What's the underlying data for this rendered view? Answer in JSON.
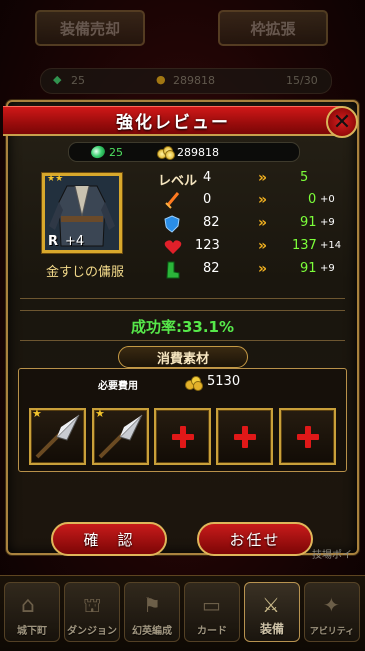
{
  "background": {
    "top_buttons": [
      "装備売却",
      "枠拡張"
    ],
    "status": {
      "gems": "25",
      "coins": "289818",
      "capacity": "15/30"
    }
  },
  "dialog": {
    "title": "強化レビュー",
    "currency": {
      "gems": "25",
      "coins": "289818"
    },
    "item": {
      "rarity": "R",
      "plus": "+4",
      "name": "金すじの傭服",
      "stars": "★★"
    },
    "stats": [
      {
        "label": "レベル",
        "icon": "level-label",
        "current": "4",
        "next": "5",
        "delta": ""
      },
      {
        "label": "",
        "icon": "sword-icon",
        "current": "0",
        "next": "0",
        "delta": "+0"
      },
      {
        "label": "",
        "icon": "shield-icon",
        "current": "82",
        "next": "91",
        "delta": "+9"
      },
      {
        "label": "",
        "icon": "heart-icon",
        "current": "123",
        "next": "137",
        "delta": "+14"
      },
      {
        "label": "",
        "icon": "boot-icon",
        "current": "82",
        "next": "91",
        "delta": "+9"
      }
    ],
    "success_rate": "成功率:33.1%",
    "materials": {
      "title": "消費素材",
      "cost_label": "必要費用",
      "cost_value": "5130",
      "slots": [
        "spear-material",
        "spear-material",
        "empty",
        "empty",
        "empty"
      ]
    },
    "buttons": {
      "confirm": "確　認",
      "auto": "お任せ"
    }
  },
  "side_tag": "技場ポイ",
  "nav": {
    "items": [
      "城下町",
      "ダンジョン",
      "幻英編成",
      "カード",
      "装備",
      "アビリティ"
    ],
    "active": "装備"
  },
  "colors": {
    "accent_gold": "#d8a82c",
    "banner_red": "#c81b1b",
    "upgrade_green": "#7cff3a"
  }
}
